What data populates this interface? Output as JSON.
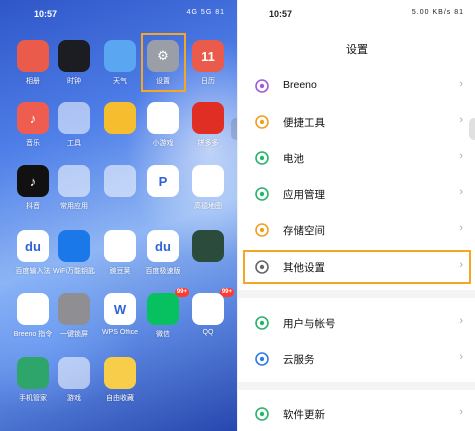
{
  "left_screen": {
    "status_bar": {
      "time": "10:57",
      "right_text": "4G 5G 81"
    },
    "apps": [
      {
        "label": "相册",
        "glyph": "",
        "color": "#ea5b4b",
        "icon": "photos-icon"
      },
      {
        "label": "时钟",
        "glyph": "",
        "color": "#1c1d22",
        "icon": "clock-icon"
      },
      {
        "label": "天气",
        "glyph": "",
        "color": "#5aa6f0",
        "icon": "weather-icon"
      },
      {
        "label": "设置",
        "glyph": "⚙",
        "color": "#9a9ea6",
        "icon": "settings-gear-icon"
      },
      {
        "label": "日历",
        "glyph": "11",
        "color": "#ea5b4b",
        "icon": "calendar-icon"
      },
      {
        "label": "音乐",
        "glyph": "♪",
        "color": "#ee5d4f",
        "icon": "music-icon"
      },
      {
        "label": "工具",
        "glyph": "",
        "color": "folder",
        "icon": "tools-folder-icon"
      },
      {
        "label": "",
        "glyph": "",
        "color": "#f6bd2e",
        "icon": "files-icon"
      },
      {
        "label": "小游戏",
        "glyph": "",
        "color": "#ffffff",
        "icon": "minigame-icon"
      },
      {
        "label": "拼多多",
        "glyph": "",
        "color": "#e02e24",
        "icon": "pinduoduo-icon"
      },
      {
        "label": "抖音",
        "glyph": "♪",
        "color": "#111111",
        "icon": "douyin-icon"
      },
      {
        "label": "常用应用",
        "glyph": "",
        "color": "folder",
        "icon": "apps-folder-icon"
      },
      {
        "label": "",
        "glyph": "",
        "color": "folder",
        "icon": "shopping-folder-icon"
      },
      {
        "label": "",
        "glyph": "P",
        "color": "#ffffff",
        "icon": "picsart-icon"
      },
      {
        "label": "高德地图",
        "glyph": "",
        "color": "#ffffff",
        "icon": "amap-icon"
      },
      {
        "label": "百度输入法",
        "glyph": "du",
        "color": "#ffffff",
        "icon": "baidu-input-icon"
      },
      {
        "label": "WiFi万能钥匙",
        "glyph": "",
        "color": "#1b78e8",
        "icon": "wifi-key-icon"
      },
      {
        "label": "豌豆荚",
        "glyph": "",
        "color": "#ffffff",
        "icon": "wandoujia-icon"
      },
      {
        "label": "百度极速版",
        "glyph": "du",
        "color": "#ffffff",
        "icon": "baidu-lite-icon"
      },
      {
        "label": "",
        "glyph": "",
        "color": "#2b4b3c",
        "icon": "game-assistant-icon"
      },
      {
        "label": "Breeno 指令",
        "glyph": "",
        "color": "#ffffff",
        "icon": "breeno-icon"
      },
      {
        "label": "一键锁屏",
        "glyph": "",
        "color": "#8e8e93",
        "icon": "lock-screen-icon"
      },
      {
        "label": "WPS Office",
        "glyph": "W",
        "color": "#ffffff",
        "icon": "wps-icon"
      },
      {
        "label": "微信",
        "glyph": "",
        "color": "#07c160",
        "icon": "wechat-icon",
        "badge": "99+"
      },
      {
        "label": "QQ",
        "glyph": "",
        "color": "#ffffff",
        "icon": "qq-icon",
        "badge": "99+"
      },
      {
        "label": "手机管家",
        "glyph": "",
        "color": "#2ea66b",
        "icon": "phone-manager-icon"
      },
      {
        "label": "游戏",
        "glyph": "",
        "color": "folder",
        "icon": "games-folder-icon"
      },
      {
        "label": "自由收藏",
        "glyph": "",
        "color": "#f8cd4a",
        "icon": "collection-icon"
      }
    ]
  },
  "right_screen": {
    "status_bar": {
      "time": "10:57",
      "right_text": "5.00 KB/s 81"
    },
    "title": "设置",
    "items": [
      {
        "label": "Breeno",
        "icon": "breeno-icon",
        "color": "#a05bd6"
      },
      {
        "label": "便捷工具",
        "icon": "tools-icon",
        "color": "#f0a020"
      },
      {
        "label": "电池",
        "icon": "battery-icon",
        "color": "#27b36b"
      },
      {
        "label": "应用管理",
        "icon": "app-manage-icon",
        "color": "#27b36b"
      },
      {
        "label": "存储空间",
        "icon": "storage-icon",
        "color": "#f0a020"
      },
      {
        "label": "其他设置",
        "icon": "more-settings-icon",
        "color": "#666666"
      },
      {
        "label": "用户与帐号",
        "icon": "user-icon",
        "color": "#27b36b"
      },
      {
        "label": "云服务",
        "icon": "cloud-icon",
        "color": "#2f7be6"
      },
      {
        "label": "软件更新",
        "icon": "update-icon",
        "color": "#27b36b"
      }
    ]
  }
}
